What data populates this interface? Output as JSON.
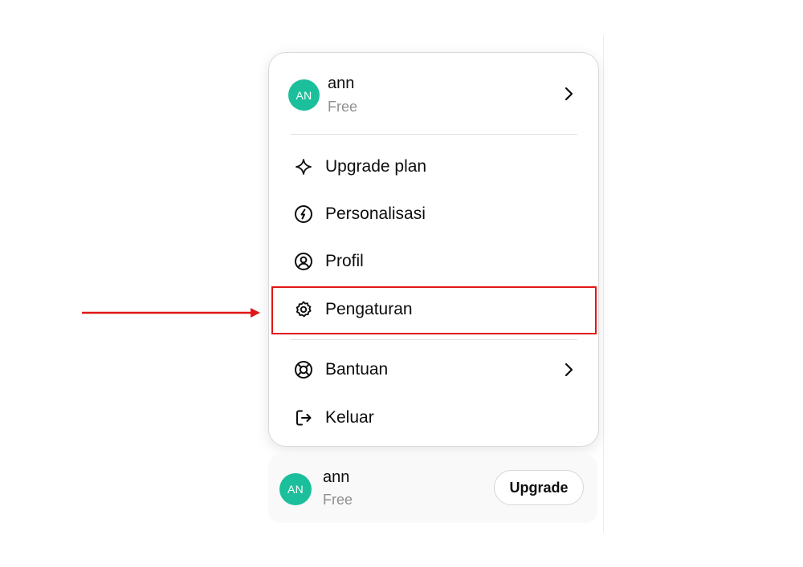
{
  "account": {
    "initials": "AN",
    "name": "ann",
    "plan": "Free"
  },
  "menu": {
    "items": [
      {
        "label": "Upgrade plan",
        "icon": "sparkle-icon"
      },
      {
        "label": "Personalisasi",
        "icon": "personalize-icon"
      },
      {
        "label": "Profil",
        "icon": "user-circle-icon"
      },
      {
        "label": "Pengaturan",
        "icon": "gear-icon"
      },
      {
        "label": "Bantuan",
        "icon": "lifebuoy-icon"
      },
      {
        "label": "Keluar",
        "icon": "logout-icon"
      }
    ]
  },
  "bottom_bar": {
    "initials": "AN",
    "name": "ann",
    "plan": "Free",
    "upgrade_label": "Upgrade"
  },
  "colors": {
    "avatar": "#1cbf9b",
    "highlight": "#e01616"
  }
}
